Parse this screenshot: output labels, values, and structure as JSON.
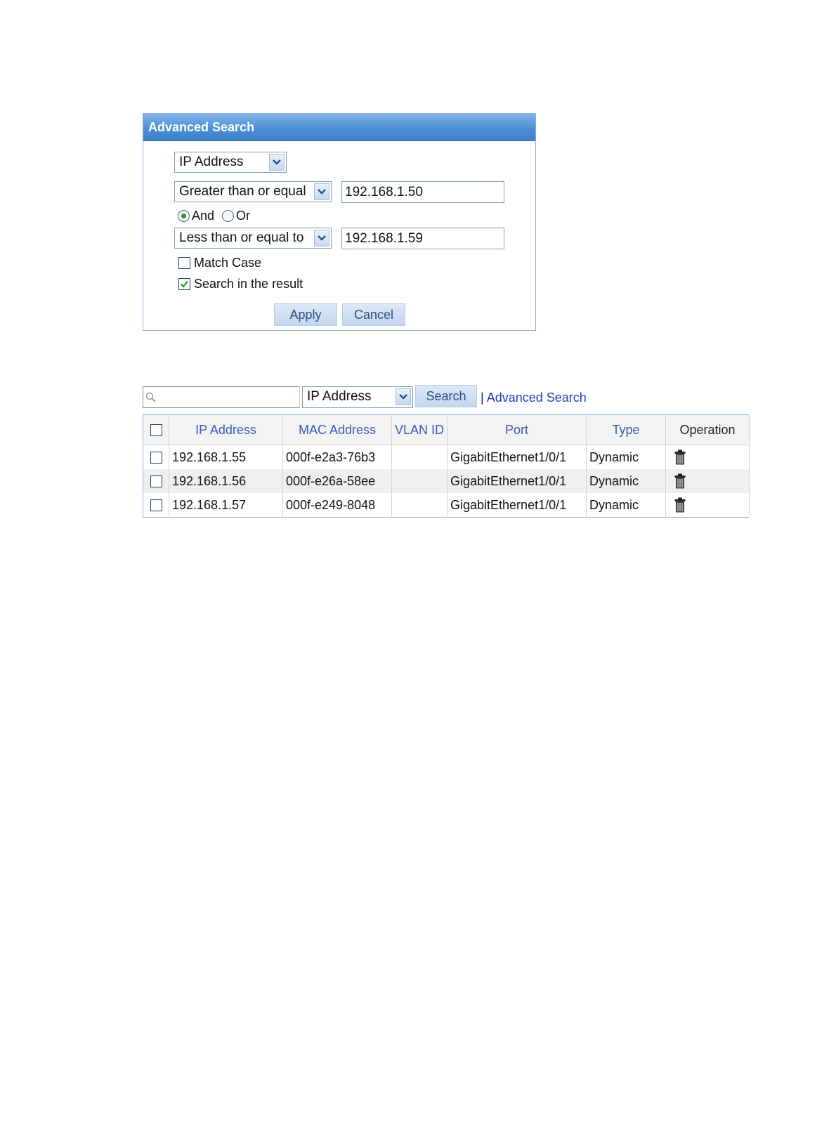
{
  "advanced_search": {
    "title": "Advanced Search",
    "field_select": "IP Address",
    "condition1": {
      "operator": "Greater than or equal",
      "value": "192.168.1.50"
    },
    "logic": {
      "and_label": "And",
      "or_label": "Or",
      "selected": "And"
    },
    "condition2": {
      "operator": "Less than or equal to",
      "value": "192.168.1.59"
    },
    "match_case": {
      "label": "Match Case",
      "checked": false
    },
    "search_in_result": {
      "label": "Search in the result",
      "checked": true
    },
    "apply_label": "Apply",
    "cancel_label": "Cancel"
  },
  "search_bar": {
    "query": "",
    "field_select": "IP Address",
    "search_label": "Search",
    "separator": "|",
    "advanced_link": "Advanced Search"
  },
  "table": {
    "columns": [
      "IP Address",
      "MAC Address",
      "VLAN ID",
      "Port",
      "Type",
      "Operation"
    ],
    "rows": [
      {
        "ip": "192.168.1.55",
        "mac": "000f-e2a3-76b3",
        "vlan": "",
        "port": "GigabitEthernet1/0/1",
        "type": "Dynamic"
      },
      {
        "ip": "192.168.1.56",
        "mac": "000f-e26a-58ee",
        "vlan": "",
        "port": "GigabitEthernet1/0/1",
        "type": "Dynamic"
      },
      {
        "ip": "192.168.1.57",
        "mac": "000f-e249-8048",
        "vlan": "",
        "port": "GigabitEthernet1/0/1",
        "type": "Dynamic"
      }
    ]
  },
  "icons": [
    "chevron-down-icon",
    "magnifier-icon",
    "trash-icon",
    "checkmark-icon"
  ],
  "colors": {
    "title_bar": "#4d8fd6",
    "link": "#1f3fbf",
    "header_text": "#3b5bb5",
    "button_text": "#2b4f85"
  }
}
